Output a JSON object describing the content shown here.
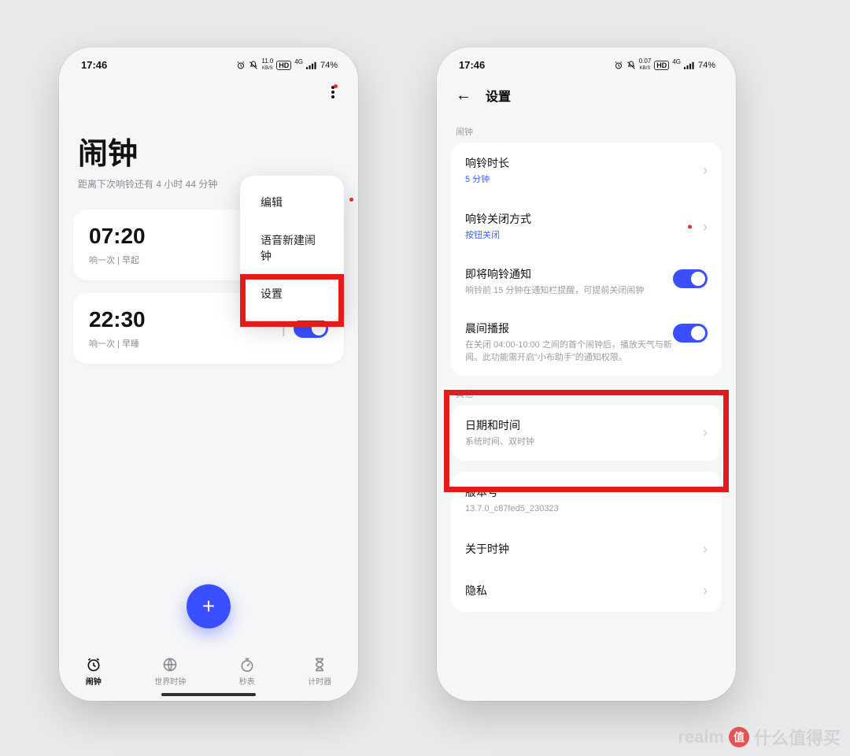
{
  "status": {
    "time": "17:46",
    "net_speed": "11.0",
    "net_unit": "KB/S",
    "hd": "HD",
    "signal": "4G",
    "battery": "74%"
  },
  "status2": {
    "time": "17:46",
    "net_speed": "0.07",
    "net_unit": "KB/S",
    "hd": "HD",
    "signal": "4G",
    "battery": "74%"
  },
  "left": {
    "title": "闹钟",
    "subtitle": "距离下次响铃还有 4 小时 44 分钟",
    "alarms": [
      {
        "time": "07:20",
        "desc": "响一次 | 早起",
        "on": true
      },
      {
        "time": "22:30",
        "desc": "响一次 | 早睡",
        "on": true
      }
    ],
    "menu": {
      "edit": "编辑",
      "voice": "语音新建闹钟",
      "settings": "设置"
    },
    "tabs": {
      "alarm": "闹钟",
      "world": "世界时钟",
      "stopwatch": "秒表",
      "timer": "计时器"
    },
    "fab": "+"
  },
  "right": {
    "back_title": "设置",
    "section_alarm": "闹钟",
    "ring_duration": {
      "label": "响铃时长",
      "value": "5 分钟"
    },
    "close_method": {
      "label": "响铃关闭方式",
      "value": "按钮关闭"
    },
    "upcoming": {
      "label": "即将响铃通知",
      "desc": "响铃前 15 分钟在通知栏提醒，可提前关闭闹钟"
    },
    "morning": {
      "label": "晨间播报",
      "desc": "在关闭 04:00-10:00 之间的首个闹钟后，播放天气与新闻。此功能需开启\"小布助手\"的通知权限。"
    },
    "section_other": "其他",
    "datetime": {
      "label": "日期和时间",
      "value": "系统时间、双时钟"
    },
    "version": {
      "label": "版本号",
      "value": "13.7.0_c87fed5_230323"
    },
    "about": "关于时钟",
    "privacy": "隐私"
  },
  "watermark": {
    "brand": "realm",
    "logo": "值",
    "tail": "什么值得买"
  }
}
